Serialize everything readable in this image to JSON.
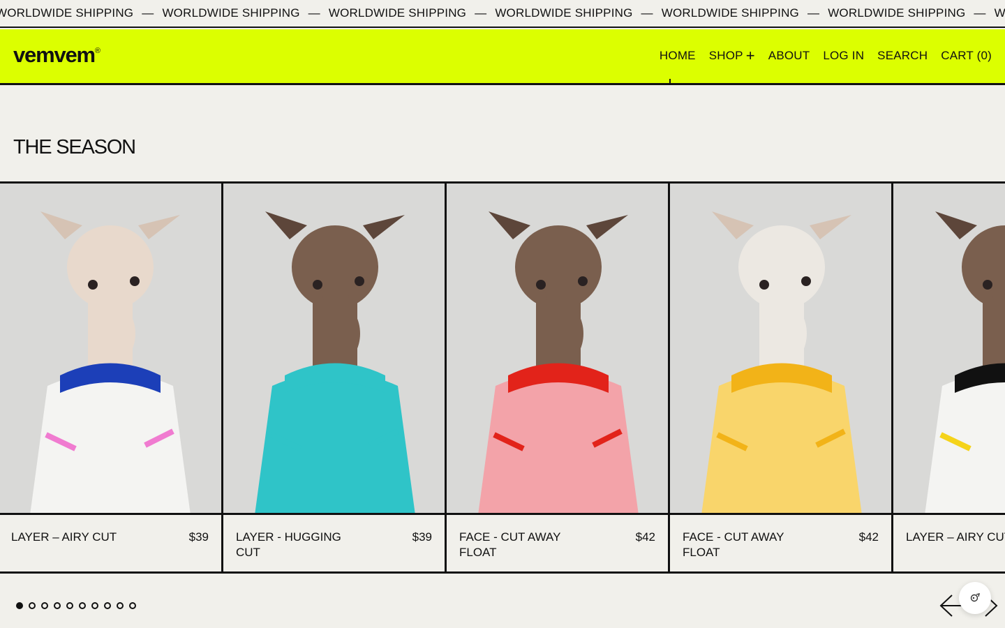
{
  "ticker": {
    "items": [
      "WORLDWIDE SHIPPING",
      "WORLDWIDE SHIPPING",
      "WORLDWIDE SHIPPING",
      "WORLDWIDE SHIPPING",
      "WORLDWIDE SHIPPING",
      "WORLDWIDE SHIPPING",
      "W"
    ],
    "separator": "—"
  },
  "header": {
    "logo": "vemvem",
    "logo_mark": "®",
    "nav": {
      "home": "HOME",
      "shop": "SHOP",
      "shop_plus": "+",
      "about": "ABOUT",
      "login": "LOG IN",
      "search": "SEARCH",
      "cart": "CART (0)"
    }
  },
  "section": {
    "title": "THE SEASON"
  },
  "products": [
    {
      "name": "LAYER – AIRY CUT",
      "price": "$39",
      "dog": "cream",
      "sweater": "white",
      "collar": "#1c3fb8",
      "trim": "#f07bd0"
    },
    {
      "name": "LAYER - HUGGING CUT",
      "price": "$39",
      "dog": "brown",
      "sweater": "#2fc4c8",
      "collar": "#2fc4c8",
      "trim": "#2fc4c8"
    },
    {
      "name": "FACE - CUT AWAY FLOAT",
      "price": "$42",
      "dog": "brown",
      "sweater": "#f3a3a9",
      "collar": "#e2231a",
      "trim": "#e2231a"
    },
    {
      "name": "FACE - CUT AWAY FLOAT",
      "price": "$42",
      "dog": "white",
      "sweater": "#f9d56b",
      "collar": "#f2b318",
      "trim": "#f2b318"
    },
    {
      "name": "LAYER – AIRY CUT",
      "price": "",
      "dog": "brown",
      "sweater": "white",
      "collar": "#111111",
      "trim": "#f5d31a"
    }
  ],
  "carousel": {
    "total_slides": 10,
    "active_slide": 1
  },
  "colors": {
    "accent": "#dcff00",
    "background": "#f1f0eb",
    "ink": "#111111"
  },
  "icons": {
    "prev": "arrow-left-icon",
    "next": "arrow-right-icon",
    "chat": "chat-icon"
  }
}
